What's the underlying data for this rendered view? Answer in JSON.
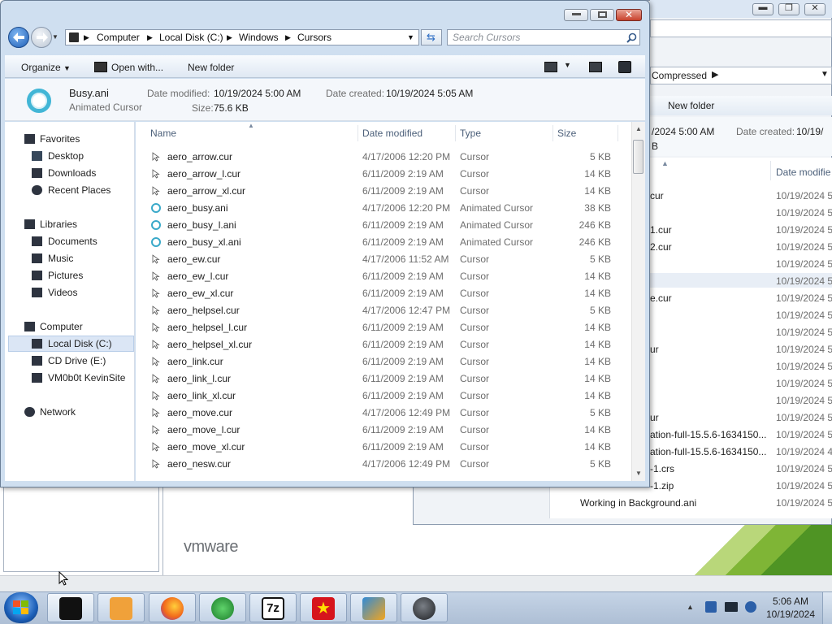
{
  "colors": {
    "window_frame": "#cfdff0",
    "selection": "#dbe6f5",
    "accent": "#2e7bd6"
  },
  "back_window": {
    "path_label": "Compressed",
    "toolbar_new_folder": "New folder",
    "details_modified": "/2024 5:00 AM",
    "details_created_label": "Date created:",
    "details_created_value": "10/19/",
    "details_size": "B",
    "col_date": "Date modifie",
    "rows": [
      {
        "name": "cur",
        "date": "10/19/2024 5:"
      },
      {
        "name": "",
        "date": "10/19/2024 5:"
      },
      {
        "name": "1.cur",
        "date": "10/19/2024 5:"
      },
      {
        "name": "2.cur",
        "date": "10/19/2024 5:"
      },
      {
        "name": "",
        "date": "10/19/2024 5:"
      },
      {
        "name": "",
        "date": "10/19/2024 5:"
      },
      {
        "name": "e.cur",
        "date": "10/19/2024 5:"
      },
      {
        "name": "",
        "date": "10/19/2024 5:"
      },
      {
        "name": "",
        "date": "10/19/2024 5:"
      },
      {
        "name": "ur",
        "date": "10/19/2024 5:"
      },
      {
        "name": "",
        "date": "10/19/2024 5:"
      },
      {
        "name": "",
        "date": "10/19/2024 5:"
      },
      {
        "name": "",
        "date": "10/19/2024 5:"
      },
      {
        "name": "ur",
        "date": "10/19/2024 5:"
      },
      {
        "name": "ation-full-15.5.6-1634150...",
        "date": "10/19/2024 5:"
      },
      {
        "name": "ation-full-15.5.6-1634150...",
        "date": "10/19/2024 4:"
      },
      {
        "name": "-1.crs",
        "date": "10/19/2024 5:"
      },
      {
        "name": "-1.zip",
        "date": "10/19/2024 5:"
      },
      {
        "name": "Working in Background.ani",
        "date": "10/19/2024 5:"
      }
    ]
  },
  "window": {
    "breadcrumb": [
      "Computer",
      "Local Disk (C:)",
      "Windows",
      "Cursors"
    ],
    "search_placeholder": "Search Cursors",
    "toolbar": {
      "organize": "Organize",
      "open_with": "Open with...",
      "new_folder": "New folder"
    },
    "details": {
      "file_name": "Busy.ani",
      "file_type": "Animated Cursor",
      "modified_label": "Date modified:",
      "modified_value": "10/19/2024 5:00 AM",
      "created_label": "Date created:",
      "created_value": "10/19/2024 5:05 AM",
      "size_label": "Size:",
      "size_value": "75.6 KB"
    },
    "nav": {
      "favorites": "Favorites",
      "favorites_items": [
        "Desktop",
        "Downloads",
        "Recent Places"
      ],
      "libraries": "Libraries",
      "libraries_items": [
        "Documents",
        "Music",
        "Pictures",
        "Videos"
      ],
      "computer": "Computer",
      "computer_items": [
        "Local Disk (C:)",
        "CD Drive (E:)",
        "VM0b0t KevinSite"
      ],
      "network": "Network"
    },
    "columns": {
      "name": "Name",
      "date": "Date modified",
      "type": "Type",
      "size": "Size"
    },
    "files": [
      {
        "name": "aero_arrow.cur",
        "date": "4/17/2006 12:20 PM",
        "type": "Cursor",
        "size": "5 KB"
      },
      {
        "name": "aero_arrow_l.cur",
        "date": "6/11/2009 2:19 AM",
        "type": "Cursor",
        "size": "14 KB"
      },
      {
        "name": "aero_arrow_xl.cur",
        "date": "6/11/2009 2:19 AM",
        "type": "Cursor",
        "size": "14 KB"
      },
      {
        "name": "aero_busy.ani",
        "date": "4/17/2006 12:20 PM",
        "type": "Animated Cursor",
        "size": "38 KB"
      },
      {
        "name": "aero_busy_l.ani",
        "date": "6/11/2009 2:19 AM",
        "type": "Animated Cursor",
        "size": "246 KB"
      },
      {
        "name": "aero_busy_xl.ani",
        "date": "6/11/2009 2:19 AM",
        "type": "Animated Cursor",
        "size": "246 KB"
      },
      {
        "name": "aero_ew.cur",
        "date": "4/17/2006 11:52 AM",
        "type": "Cursor",
        "size": "5 KB"
      },
      {
        "name": "aero_ew_l.cur",
        "date": "6/11/2009 2:19 AM",
        "type": "Cursor",
        "size": "14 KB"
      },
      {
        "name": "aero_ew_xl.cur",
        "date": "6/11/2009 2:19 AM",
        "type": "Cursor",
        "size": "14 KB"
      },
      {
        "name": "aero_helpsel.cur",
        "date": "4/17/2006 12:47 PM",
        "type": "Cursor",
        "size": "5 KB"
      },
      {
        "name": "aero_helpsel_l.cur",
        "date": "6/11/2009 2:19 AM",
        "type": "Cursor",
        "size": "14 KB"
      },
      {
        "name": "aero_helpsel_xl.cur",
        "date": "6/11/2009 2:19 AM",
        "type": "Cursor",
        "size": "14 KB"
      },
      {
        "name": "aero_link.cur",
        "date": "6/11/2009 2:19 AM",
        "type": "Cursor",
        "size": "14 KB"
      },
      {
        "name": "aero_link_l.cur",
        "date": "6/11/2009 2:19 AM",
        "type": "Cursor",
        "size": "14 KB"
      },
      {
        "name": "aero_link_xl.cur",
        "date": "6/11/2009 2:19 AM",
        "type": "Cursor",
        "size": "14 KB"
      },
      {
        "name": "aero_move.cur",
        "date": "4/17/2006 12:49 PM",
        "type": "Cursor",
        "size": "5 KB"
      },
      {
        "name": "aero_move_l.cur",
        "date": "6/11/2009 2:19 AM",
        "type": "Cursor",
        "size": "14 KB"
      },
      {
        "name": "aero_move_xl.cur",
        "date": "6/11/2009 2:19 AM",
        "type": "Cursor",
        "size": "14 KB"
      },
      {
        "name": "aero_nesw.cur",
        "date": "4/17/2006 12:49 PM",
        "type": "Cursor",
        "size": "5 KB"
      }
    ]
  },
  "vmware_label": "vmware",
  "clock": {
    "time": "5:06 AM",
    "date": "10/19/2024"
  }
}
